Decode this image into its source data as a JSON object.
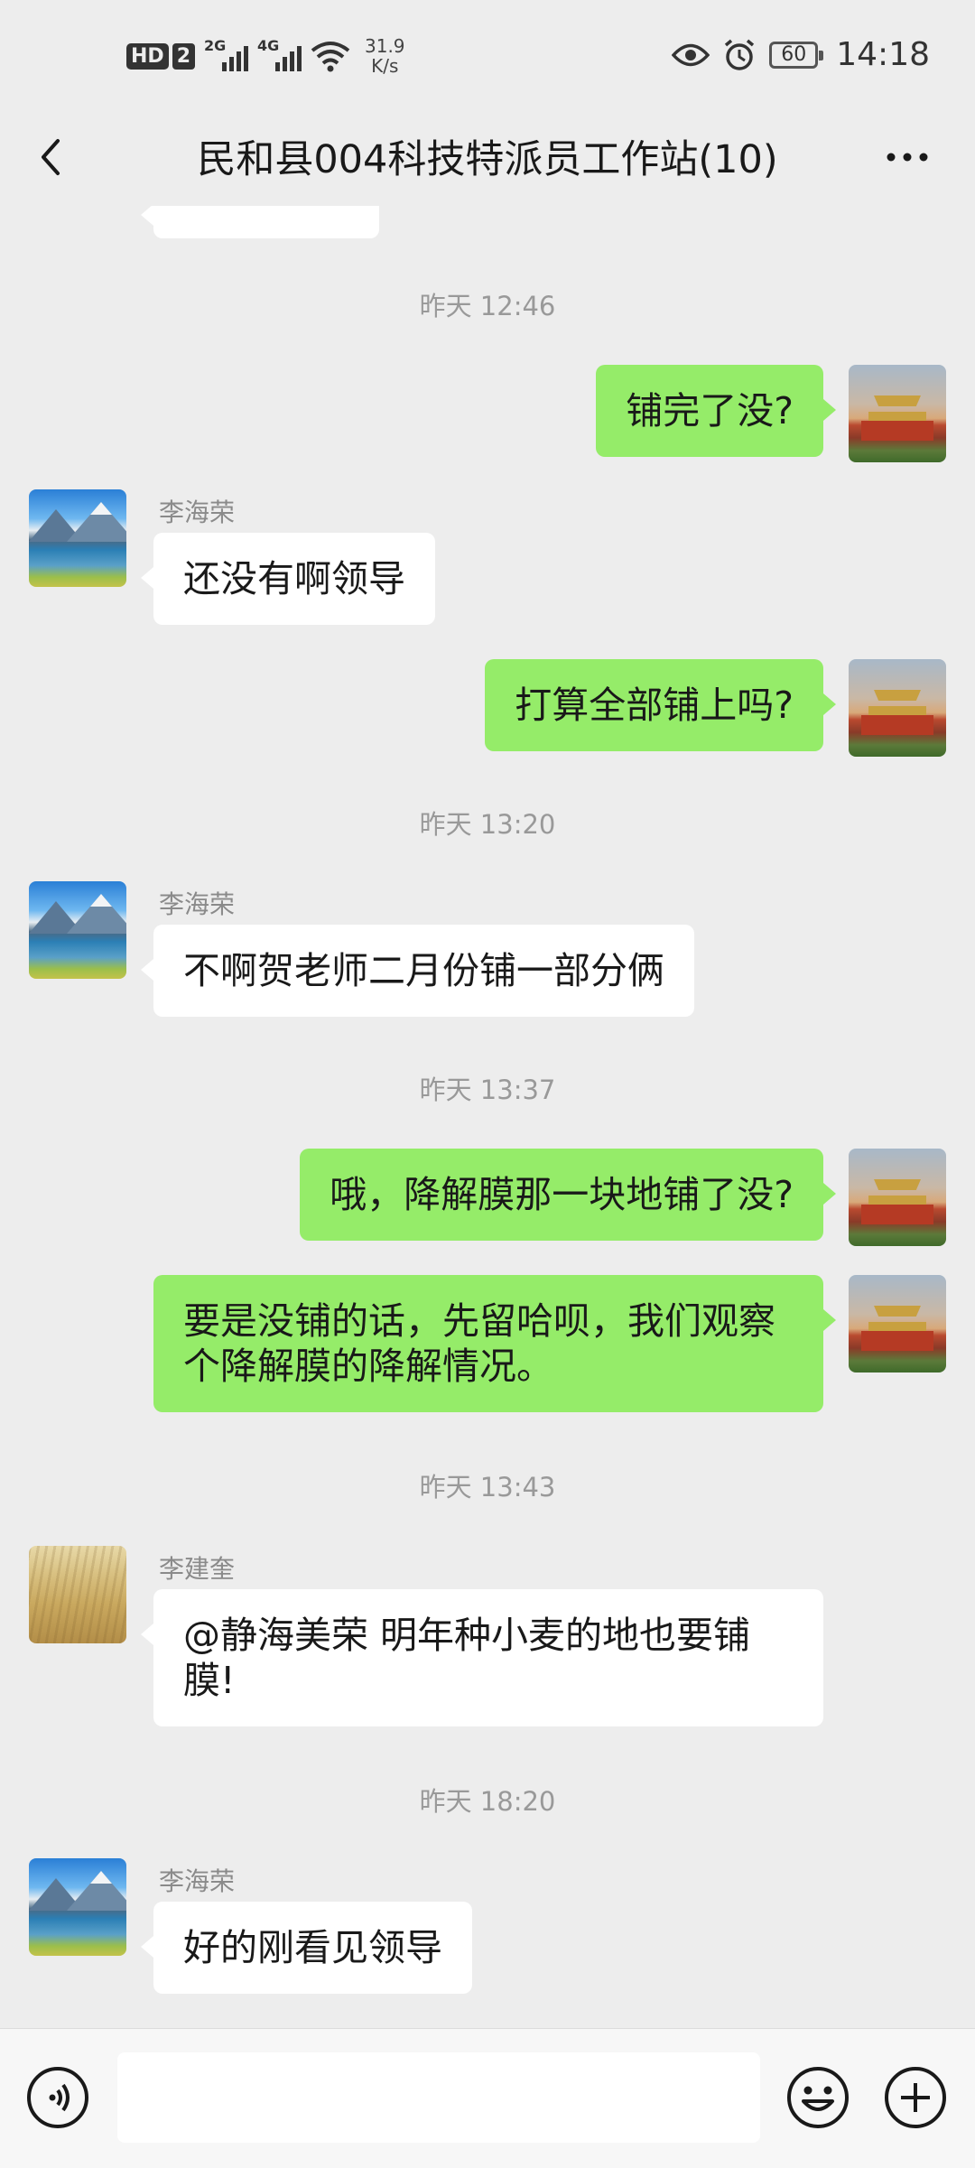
{
  "status_bar": {
    "hd": "HD",
    "sim": "2",
    "sig1_gen": "2G",
    "sig2_gen": "4G",
    "speed_value": "31.9",
    "speed_unit": "K/s",
    "battery": "60",
    "time": "14:18"
  },
  "header": {
    "title": "民和县004科技特派员工作站(10)",
    "back_icon": "chevron-left-icon",
    "more_icon": "more-dots-icon"
  },
  "chat": {
    "time_1": "昨天 12:46",
    "msg_1": "铺完了没?",
    "sender_1": "李海荣",
    "msg_2": "还没有啊领导",
    "msg_3": "打算全部铺上吗?",
    "time_2": "昨天 13:20",
    "sender_2": "李海荣",
    "msg_4": "不啊贺老师二月份铺一部分俩",
    "time_3": "昨天 13:37",
    "msg_5": "哦，降解膜那一块地铺了没?",
    "msg_6": "要是没铺的话，先留哈呗，我们观察个降解膜的降解情况。",
    "time_4": "昨天 13:43",
    "sender_3": "李建奎",
    "msg_7": "@静海美荣  明年种小麦的地也要铺膜!",
    "time_5": "昨天 18:20",
    "sender_4": "李海荣",
    "msg_8": "好的刚看见领导"
  },
  "input_bar": {
    "voice_icon": "voice-icon",
    "emoji_icon": "emoji-icon",
    "plus_icon": "plus-icon",
    "placeholder": ""
  },
  "colors": {
    "background": "#ededed",
    "outgoing_bubble": "#95ec69",
    "incoming_bubble": "#ffffff",
    "timestamp": "#999999",
    "sender_name": "#8a8a8a"
  }
}
